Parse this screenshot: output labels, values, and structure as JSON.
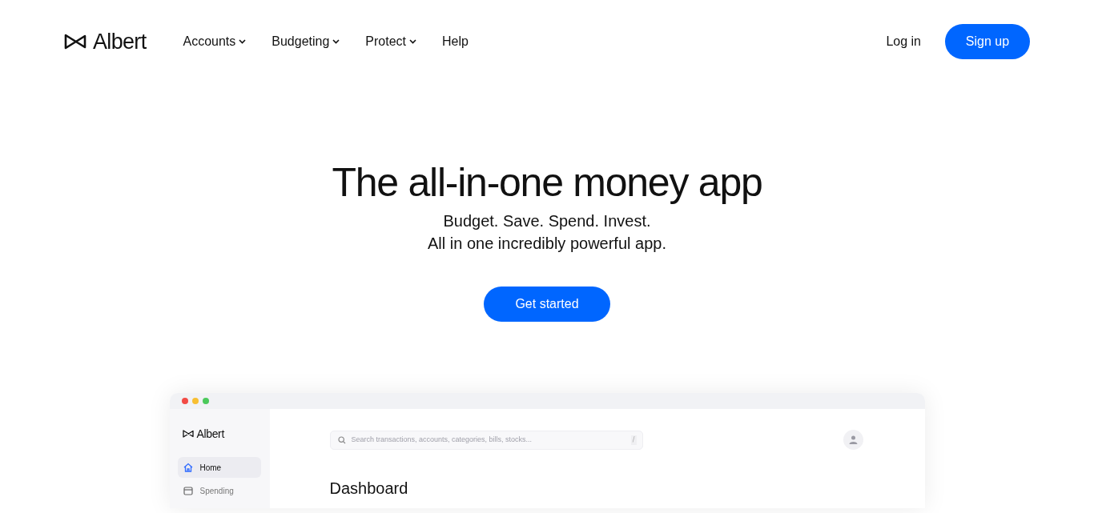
{
  "header": {
    "logo": "Albert",
    "nav": [
      {
        "label": "Accounts",
        "dropdown": true
      },
      {
        "label": "Budgeting",
        "dropdown": true
      },
      {
        "label": "Protect",
        "dropdown": true
      },
      {
        "label": "Help",
        "dropdown": false
      }
    ],
    "login": "Log in",
    "signup": "Sign up"
  },
  "hero": {
    "title": "The all-in-one money app",
    "subtitle_lines": [
      "Budget. Save. Spend. Invest.",
      "All in one incredibly powerful app."
    ],
    "cta": "Get started"
  },
  "app_preview": {
    "logo": "Albert",
    "sidebar": {
      "items": [
        {
          "label": "Home",
          "kind": "home",
          "selected": true
        },
        {
          "label": "Spending",
          "kind": "wallet",
          "selected": false
        }
      ]
    },
    "search": {
      "placeholder": "Search transactions, accounts, categories, bills, stocks...",
      "shortcut": "/"
    },
    "heading": "Dashboard"
  }
}
